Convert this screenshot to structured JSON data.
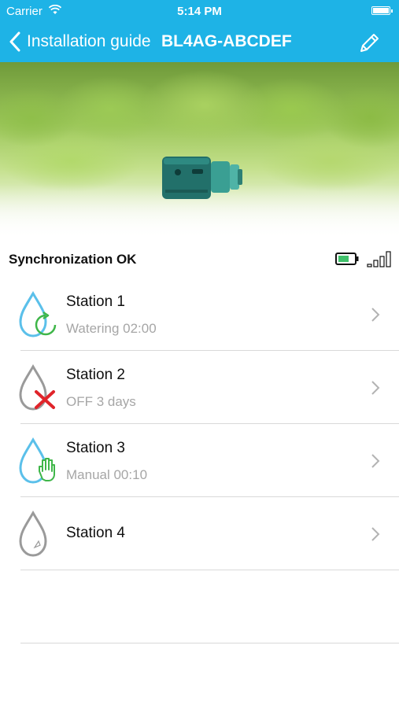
{
  "status_bar": {
    "carrier": "Carrier",
    "time": "5:14 PM"
  },
  "nav": {
    "back_label": "Installation guide",
    "title": "BL4AG-ABCDEF",
    "edit_icon": "pencil-icon"
  },
  "sync": {
    "text": "Synchronization OK",
    "battery_icon": "battery-icon",
    "signal_icon": "signal-icon"
  },
  "stations": [
    {
      "name": "Station 1",
      "status": "Watering 02:00",
      "icon": "drop-watering-icon"
    },
    {
      "name": "Station 2",
      "status": "OFF 3 days",
      "icon": "drop-off-icon"
    },
    {
      "name": "Station 3",
      "status": "Manual 00:10",
      "icon": "drop-manual-icon"
    },
    {
      "name": "Station 4",
      "status": "",
      "icon": "drop-idle-icon"
    }
  ],
  "colors": {
    "accent": "#1eb3e6",
    "water_blue": "#5bc0ea",
    "green": "#3fb649",
    "red": "#e0242a",
    "grey": "#9a9a9a"
  }
}
